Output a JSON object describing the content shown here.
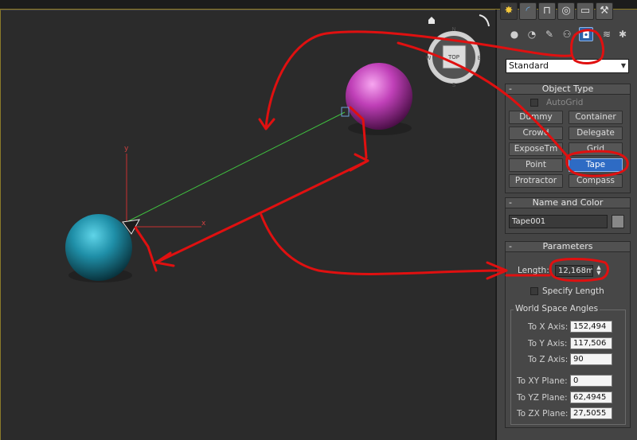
{
  "viewport": {
    "gizmo_axes": {
      "y": "y",
      "x": "x"
    },
    "viewcube": {
      "face": "TOP",
      "compass_n": "N",
      "compass_s": "S",
      "compass_w": "W",
      "compass_e": "E"
    }
  },
  "command_panel": {
    "tabs": [
      {
        "icon": "create-icon"
      },
      {
        "icon": "modify-icon"
      },
      {
        "icon": "hierarchy-icon"
      },
      {
        "icon": "motion-icon"
      },
      {
        "icon": "display-icon"
      },
      {
        "icon": "utilities-icon"
      }
    ],
    "categories": [
      {
        "icon": "geometry-icon"
      },
      {
        "icon": "shapes-icon"
      },
      {
        "icon": "lights-icon"
      },
      {
        "icon": "cameras-icon"
      },
      {
        "icon": "helpers-icon"
      },
      {
        "icon": "space-warps-icon"
      },
      {
        "icon": "systems-icon"
      }
    ],
    "dropdown_value": "Standard",
    "object_type": {
      "title": "Object Type",
      "autogrid_label": "AutoGrid",
      "buttons": [
        "Dummy",
        "Container",
        "Crowd",
        "Delegate",
        "ExposeTm",
        "Grid",
        "Point",
        "Tape",
        "Protractor",
        "Compass"
      ],
      "active_button": "Tape"
    },
    "name_and_color": {
      "title": "Name and Color",
      "name_value": "Tape001",
      "color": "#888888"
    },
    "parameters": {
      "title": "Parameters",
      "length_label": "Length:",
      "length_value": "12,168m",
      "specify_length_label": "Specify Length",
      "world_space_angles_title": "World Space Angles",
      "angles": [
        {
          "label": "To X Axis:",
          "value": "152,494"
        },
        {
          "label": "To Y Axis:",
          "value": "117,506"
        },
        {
          "label": "To Z Axis:",
          "value": "90"
        },
        {
          "label": "To XY Plane:",
          "value": "0"
        },
        {
          "label": "To YZ Plane:",
          "value": "62,4945"
        },
        {
          "label": "To ZX Plane:",
          "value": "27,5055"
        }
      ]
    }
  },
  "colors": {
    "annotation_red": "#e01010",
    "tape_line_green": "#3fbf3f",
    "sphere_teal": "#1f8fa8",
    "sphere_magenta": "#c040b8",
    "active_blue": "#2e6bc4"
  }
}
